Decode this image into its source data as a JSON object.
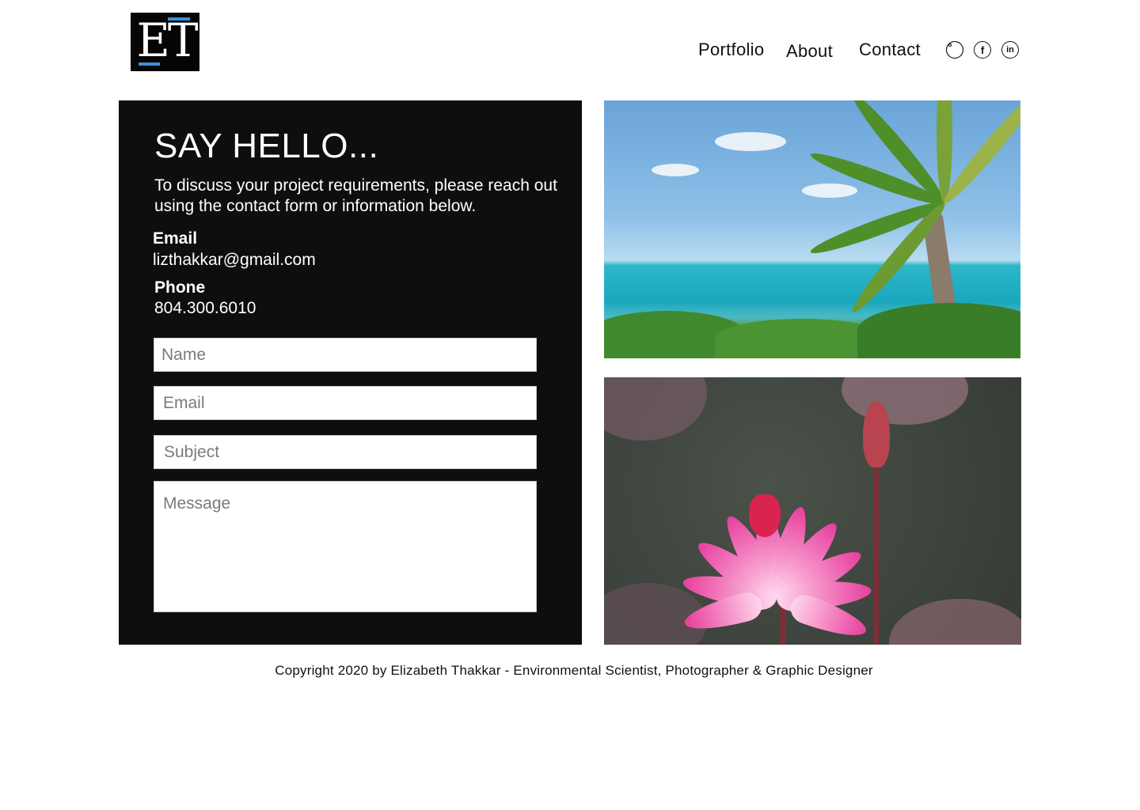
{
  "logo": {
    "letters": "ET"
  },
  "nav": {
    "items": [
      {
        "label": "Portfolio"
      },
      {
        "label": "About"
      },
      {
        "label": "Contact"
      }
    ]
  },
  "social": {
    "instagram": "instagram-icon",
    "facebook": "facebook-icon",
    "linkedin": "linkedin-icon",
    "facebook_glyph": "f",
    "linkedin_glyph": "in"
  },
  "contact": {
    "title": "SAY HELLO...",
    "intro": "To discuss your project requirements, please reach out using the contact form or information below.",
    "email_label": "Email",
    "email_value": "lizthakkar@gmail.com",
    "phone_label": "Phone",
    "phone_value": "804.300.6010"
  },
  "form": {
    "name_placeholder": "Name",
    "email_placeholder": "Email",
    "subject_placeholder": "Subject",
    "message_placeholder": "Message"
  },
  "footer": {
    "text": "Copyright 2020 by Elizabeth Thakkar - Environmental Scientist, Photographer & Graphic Designer"
  }
}
